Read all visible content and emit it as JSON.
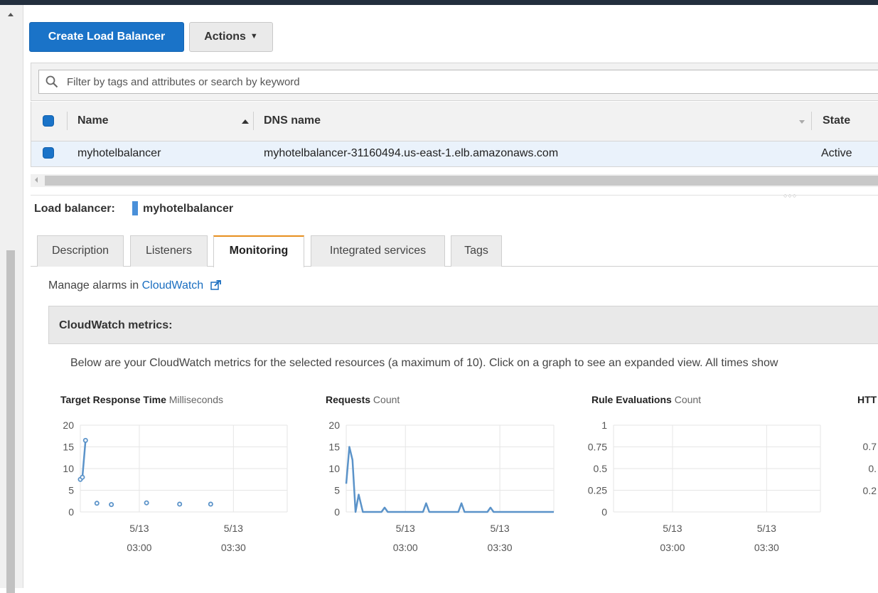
{
  "toolbar": {
    "create_label": "Create Load Balancer",
    "actions_label": "Actions"
  },
  "search": {
    "placeholder": "Filter by tags and attributes or search by keyword"
  },
  "table": {
    "columns": [
      "Name",
      "DNS name",
      "State"
    ],
    "rows": [
      {
        "name": "myhotelbalancer",
        "dns": "myhotelbalancer-31160494.us-east-1.elb.amazonaws.com",
        "state": "Active"
      }
    ]
  },
  "detail": {
    "label": "Load balancer:",
    "name": "myhotelbalancer",
    "tabs": [
      "Description",
      "Listeners",
      "Monitoring",
      "Integrated services",
      "Tags"
    ],
    "active_tab": "Monitoring",
    "manage_prefix": "Manage alarms in",
    "manage_link": "CloudWatch",
    "metrics_title": "CloudWatch metrics:",
    "metrics_desc": "Below are your CloudWatch metrics for the selected resources (a maximum of 10). Click on a graph to see an expanded view. All times show"
  },
  "colors": {
    "primary": "#1a73c8",
    "accent_tab": "#e78f1e",
    "series": "#5b93c9",
    "link": "#1a6ec0"
  },
  "chart_data": [
    {
      "type": "scatter",
      "title": "Target Response Time",
      "unit": "Milliseconds",
      "ylim": [
        0,
        20
      ],
      "yticks": [
        "20",
        "15",
        "10",
        "5",
        "0"
      ],
      "xticks": [
        [
          "5/13",
          "03:00"
        ],
        [
          "5/13",
          "03:30"
        ]
      ],
      "xlim": [
        0,
        100
      ],
      "line_segment": [
        [
          0,
          7.5
        ],
        [
          1,
          8
        ],
        [
          2.5,
          16.5
        ]
      ],
      "points": [
        [
          0,
          7.5
        ],
        [
          1,
          8
        ],
        [
          2.5,
          16.5
        ],
        [
          8,
          2
        ],
        [
          15,
          1.7
        ],
        [
          32,
          2.1
        ],
        [
          48,
          1.8
        ],
        [
          63,
          1.8
        ]
      ]
    },
    {
      "type": "line",
      "title": "Requests",
      "unit": "Count",
      "ylim": [
        0,
        20
      ],
      "yticks": [
        "20",
        "15",
        "10",
        "5",
        "0"
      ],
      "xticks": [
        [
          "5/13",
          "03:00"
        ],
        [
          "5/13",
          "03:30"
        ]
      ],
      "xlim": [
        0,
        100
      ],
      "points": [
        [
          0,
          6.5
        ],
        [
          1.5,
          15
        ],
        [
          3,
          12
        ],
        [
          4.5,
          0
        ],
        [
          6,
          4
        ],
        [
          8,
          0
        ],
        [
          17,
          0
        ],
        [
          18.5,
          1
        ],
        [
          20,
          0
        ],
        [
          37,
          0
        ],
        [
          38.5,
          2
        ],
        [
          40,
          0
        ],
        [
          54,
          0
        ],
        [
          55.5,
          2
        ],
        [
          57,
          0
        ],
        [
          68,
          0
        ],
        [
          69.5,
          1
        ],
        [
          71,
          0
        ],
        [
          100,
          0
        ]
      ]
    },
    {
      "type": "line",
      "title": "Rule Evaluations",
      "unit": "Count",
      "ylim": [
        0,
        1
      ],
      "yticks": [
        "1",
        "0.75",
        "0.5",
        "0.25",
        "0"
      ],
      "xticks": [
        [
          "5/13",
          "03:00"
        ],
        [
          "5/13",
          "03:30"
        ]
      ],
      "xlim": [
        0,
        100
      ],
      "points": []
    },
    {
      "type": "line",
      "title": "HTT",
      "unit": "",
      "ylim": [
        0,
        1
      ],
      "yticks": [
        "0.7",
        "0.",
        "0.2"
      ],
      "xticks": [],
      "xlim": [
        0,
        100
      ],
      "points": []
    }
  ]
}
